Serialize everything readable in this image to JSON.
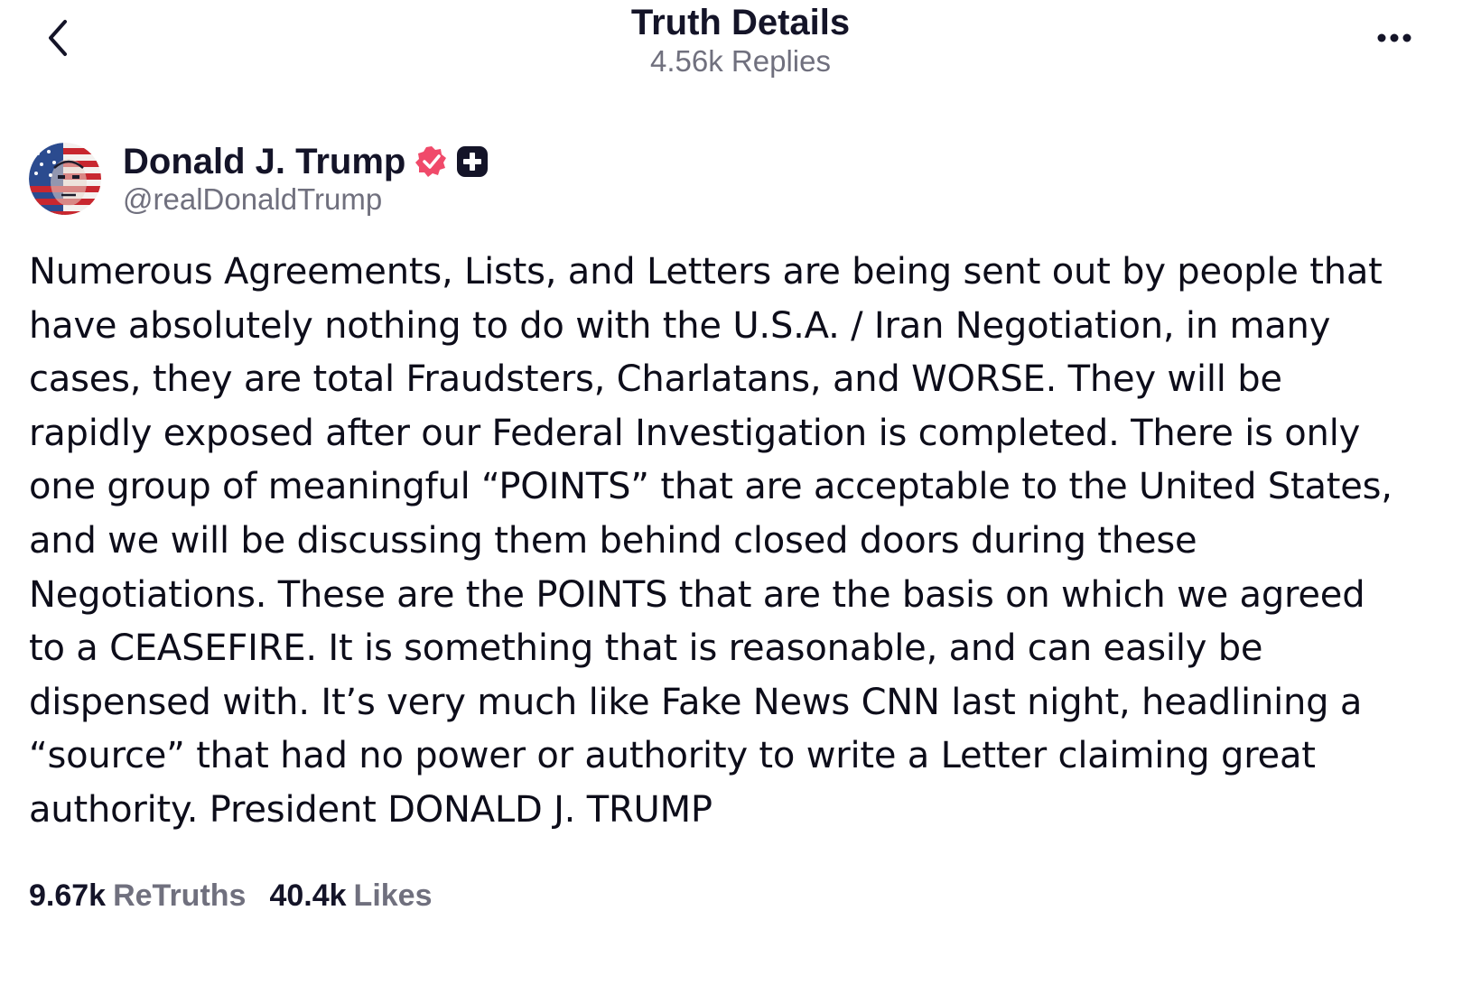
{
  "header": {
    "title": "Truth Details",
    "subtitle": "4.56k Replies",
    "back_icon": "chevron-left-icon",
    "more_icon": "more-horizontal-icon"
  },
  "author": {
    "name": "Donald J. Trump",
    "handle": "@realDonaldTrump",
    "verified_color": "#f04a6a",
    "badges": [
      "verified-icon",
      "plus-badge-icon"
    ]
  },
  "post": {
    "text": "Numerous Agreements, Lists, and Letters are being sent out by people that\nhave absolutely nothing to do with the U.S.A. / Iran Negotiation, in many\ncases, they are total Fraudsters, Charlatans, and WORSE. They will be\nrapidly exposed after our Federal Investigation is completed. There is only\none group of meaningful “POINTS” that are acceptable to the United States,\nand we will be discussing them behind closed doors during these\nNegotiations. These are the POINTS that are the basis on which we agreed\nto a CEASEFIRE. It is something that is reasonable, and can easily be\ndispensed with. It’s very much like Fake News CNN last night, headlining a\n“source” that had no power or authority to write a Letter claiming great\nauthority. President DONALD J. TRUMP"
  },
  "stats": {
    "retruths_value": "9.67k",
    "retruths_label": "ReTruths",
    "likes_value": "40.4k",
    "likes_label": "Likes"
  }
}
